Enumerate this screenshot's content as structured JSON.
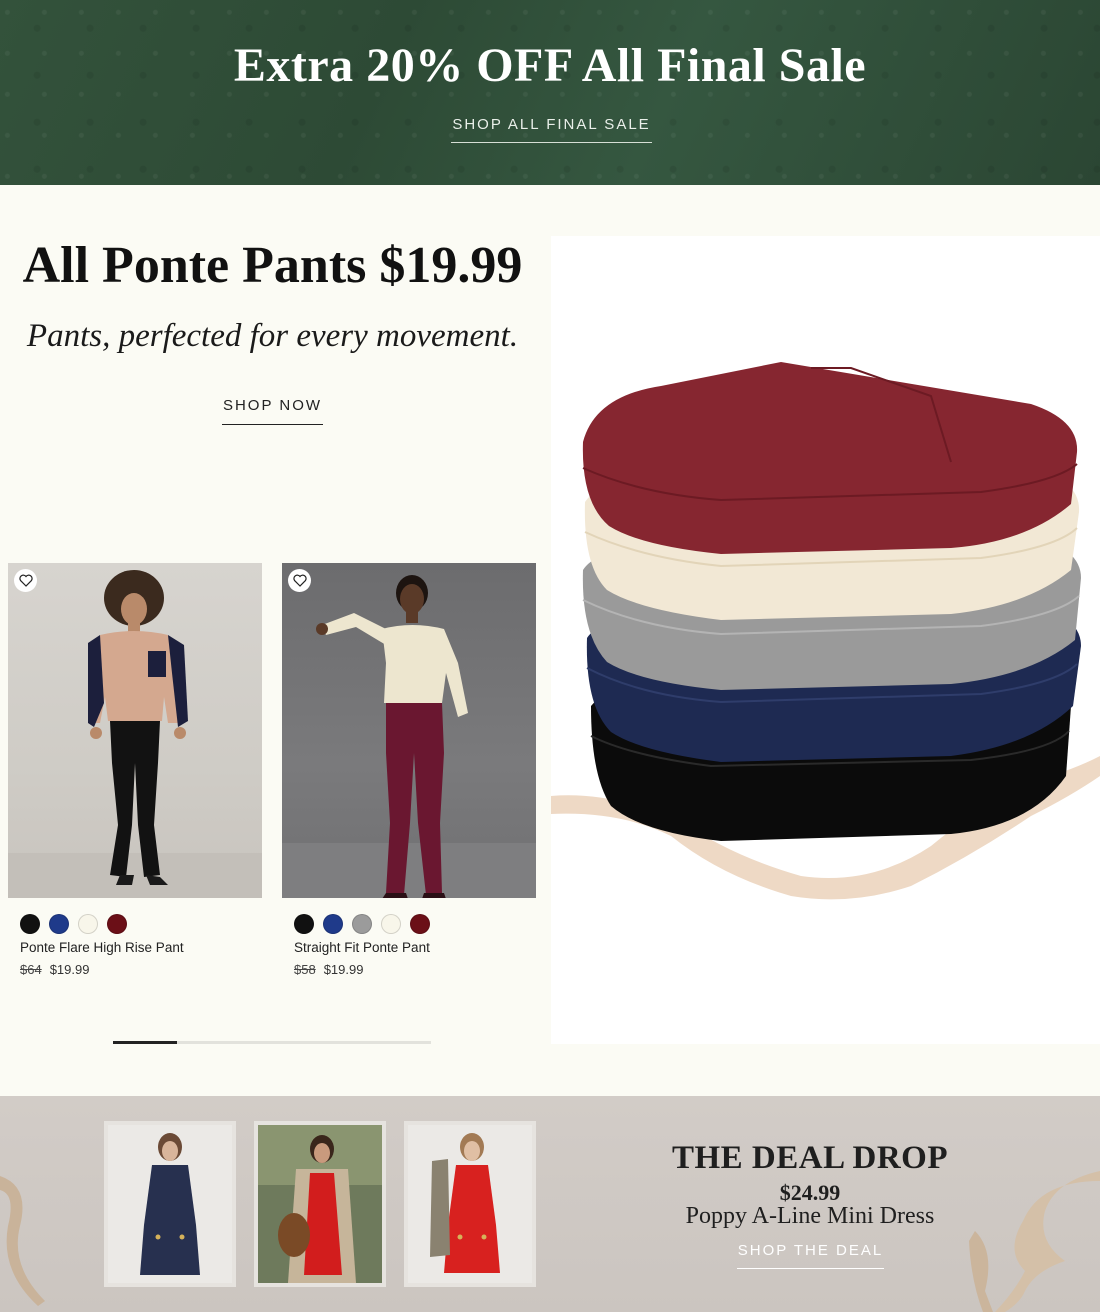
{
  "promo": {
    "headline_pre": "Extra ",
    "headline_bold": "20% OFF",
    "headline_post": " All Final Sale",
    "link_label": "SHOP ALL FINAL SALE"
  },
  "ponte": {
    "title": "All Ponte Pants $19.99",
    "subtitle": "Pants, perfected for every movement.",
    "cta_label": "SHOP NOW",
    "products": [
      {
        "name": "Ponte Flare High Rise Pant",
        "price_original": "$64",
        "price_sale": "$19.99",
        "swatches": [
          "#111111",
          "#1f3a8a",
          "#f8f6ea",
          "#6b0f17"
        ]
      },
      {
        "name": "Straight Fit Ponte Pant",
        "price_original": "$58",
        "price_sale": "$19.99",
        "swatches": [
          "#111111",
          "#1f3a8a",
          "#9b9b9b",
          "#f8f6ea",
          "#6b0f17"
        ]
      }
    ]
  },
  "deal": {
    "title": "THE DEAL DROP",
    "price": "$24.99",
    "product_name": "Poppy A-Line Mini Dress",
    "link_label": "SHOP THE DEAL"
  }
}
